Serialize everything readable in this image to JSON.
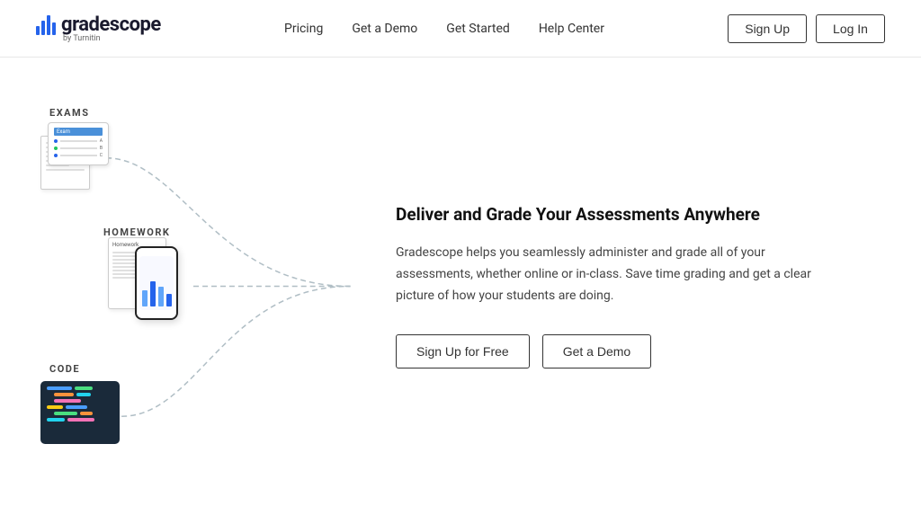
{
  "header": {
    "logo_text": "gradescope",
    "logo_subtext": "by Turnitin",
    "nav": {
      "items": [
        {
          "label": "Pricing",
          "id": "pricing"
        },
        {
          "label": "Get a Demo",
          "id": "get-a-demo"
        },
        {
          "label": "Get Started",
          "id": "get-started"
        },
        {
          "label": "Help Center",
          "id": "help-center"
        }
      ],
      "signup_label": "Sign Up",
      "login_label": "Log In"
    }
  },
  "left": {
    "exams_label": "EXAMS",
    "homework_label": "HOMEWORK",
    "code_label": "CODE"
  },
  "main": {
    "tagline": "Deliver and Grade Your Assessments Anywhere",
    "description": "Gradescope helps you seamlessly administer and grade all of your assessments, whether online or in-class. Save time grading and get a clear picture of how your students are doing.",
    "signup_btn": "Sign Up for Free",
    "demo_btn": "Get a Demo"
  }
}
